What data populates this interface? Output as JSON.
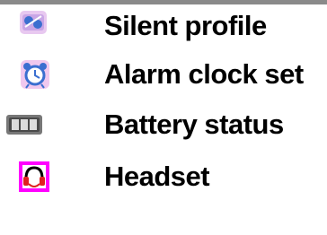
{
  "status_icons": [
    {
      "icon": "silent-profile-icon",
      "label": "Silent profile"
    },
    {
      "icon": "alarm-clock-icon",
      "label": "Alarm clock set"
    },
    {
      "icon": "battery-status-icon",
      "label": "Battery status"
    },
    {
      "icon": "headset-icon",
      "label": "Headset"
    }
  ],
  "colors": {
    "header_bar": "#8a8a8a",
    "icon_blue": "#3b6fd0",
    "icon_pink": "#d88ad0",
    "icon_magenta": "#ff00ff",
    "icon_red": "#e02020",
    "battery_gray": "#777777"
  }
}
